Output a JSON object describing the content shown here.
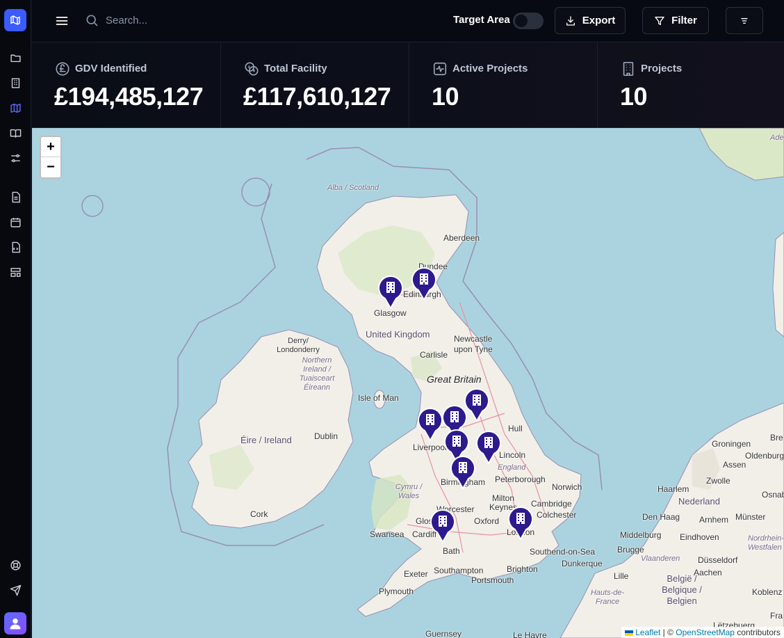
{
  "topbar": {
    "search_placeholder": "Search...",
    "target_area_label": "Target Area",
    "export_label": "Export",
    "filter_label": "Filter"
  },
  "stats": [
    {
      "label": "GDV Identified",
      "value": "£194,485,127",
      "icon": "pound-coin-icon"
    },
    {
      "label": "Total Facility",
      "value": "£117,610,127",
      "icon": "coins-icon"
    },
    {
      "label": "Active Projects",
      "value": "10",
      "icon": "activity-icon"
    },
    {
      "label": "Projects",
      "value": "10",
      "icon": "building-icon"
    }
  ],
  "map": {
    "zoom_in": "+",
    "zoom_out": "−",
    "labels": {
      "alba": "Alba / Scotland",
      "aberdeen": "Aberdeen",
      "dundee": "Dundee",
      "edinburgh": "Edinburgh",
      "glasgow": "Glasgow",
      "uk": "United Kingdom",
      "newcastle": "Newcastle upon Tyne",
      "derry": "Derry/ Londonderry",
      "ni": "Northern Ireland / Tuaisceart Éireann",
      "carlisle": "Carlisle",
      "gb": "Great Britain",
      "iom": "Isle of Man",
      "eire": "Éire / Ireland",
      "dublin": "Dublin",
      "liverpool": "Liverpool",
      "hull": "Hull",
      "lincoln": "Lincoln",
      "england": "England",
      "birmingham": "Birmingham",
      "peterborough": "Peterborough",
      "norwich": "Norwich",
      "cork": "Cork",
      "wales": "Cymru / Wales",
      "worcester": "Worcester",
      "milton": "Milton Keynes",
      "cambridge": "Cambridge",
      "colchester": "Colchester",
      "glos": "Glos",
      "oxford": "Oxford",
      "swansea": "Swansea",
      "cardiff": "Cardiff",
      "london": "London",
      "southend": "Southend-on-Sea",
      "bath": "Bath",
      "exeter": "Exeter",
      "southampton": "Southampton",
      "portsmouth": "Portsmouth",
      "brighton": "Brighton",
      "plymouth": "Plymouth",
      "dunkerque": "Dunkerque",
      "hauts": "Hauts-de-France",
      "lille": "Lille",
      "belgie": "België / Belgique / Belgien",
      "vlaanderen": "Vlaanderen",
      "brugge": "Brugge",
      "middelburg": "Middelburg",
      "denhaag": "Den Haag",
      "nederland": "Nederland",
      "haarlem": "Haarlem",
      "zwolle": "Zwolle",
      "assen": "Assen",
      "groningen": "Groningen",
      "oldenburg": "Oldenburg",
      "osnab": "Osnab",
      "arnhem": "Arnhem",
      "munster": "Münster",
      "eindhoven": "Eindhoven",
      "nrw": "Nordrhein-Westfalen",
      "dusseldorf": "Düsseldorf",
      "aachen": "Aachen",
      "koblenz": "Koblenz",
      "letzebuerg": "Lëtzebuerg",
      "guernsey": "Guernsey",
      "lehavre": "Le Havre",
      "fra": "Fra",
      "bre": "Bre",
      "ade": "Ade"
    },
    "attribution": {
      "leaflet": "Leaflet",
      "sep": " | © ",
      "osm": "OpenStreetMap",
      "contributors": " contributors"
    }
  },
  "colors": {
    "accent": "#3b5bfd",
    "marker": "#2d1a8c",
    "sea": "#aad3df",
    "land": "#f2efe9"
  }
}
